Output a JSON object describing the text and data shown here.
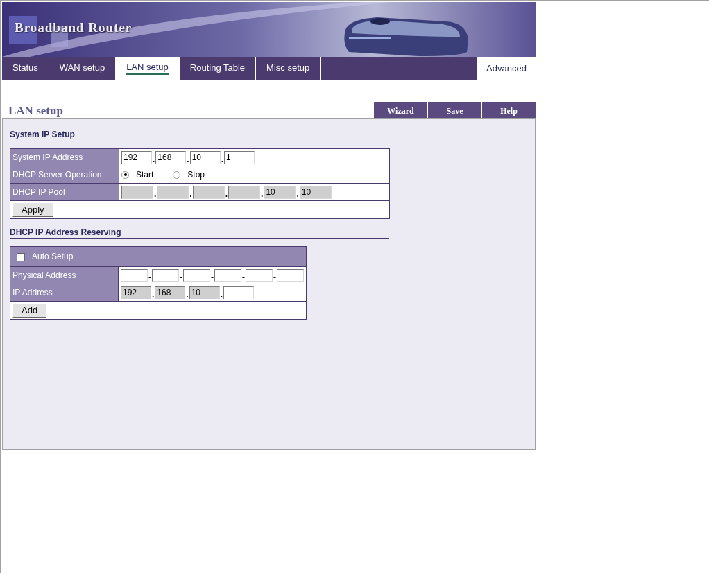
{
  "header": {
    "logo": "Broadband Router"
  },
  "tabs": [
    {
      "label": "Status",
      "selected": false
    },
    {
      "label": "WAN setup",
      "selected": false
    },
    {
      "label": "LAN setup",
      "selected": true
    },
    {
      "label": "Routing Table",
      "selected": false
    },
    {
      "label": "Misc setup",
      "selected": false
    }
  ],
  "advanced_tab": {
    "label": "Advanced",
    "selected": true
  },
  "page_title": "LAN setup",
  "actions": [
    "Wizard",
    "Save",
    "Help"
  ],
  "system_ip": {
    "title": "System IP Setup",
    "rows": [
      {
        "kind": "ip",
        "label": "System IP Address",
        "separator": ".",
        "fields": [
          {
            "value": "192",
            "disabled": false
          },
          {
            "value": "168",
            "disabled": false
          },
          {
            "value": "10",
            "disabled": false
          },
          {
            "value": "1",
            "disabled": false
          }
        ]
      },
      {
        "kind": "radio",
        "label": "DHCP Server Operation",
        "options": [
          {
            "label": "Start",
            "selected": true
          },
          {
            "label": "Stop",
            "selected": false
          }
        ]
      },
      {
        "kind": "pool",
        "label": "DHCP IP Pool",
        "separator": ".",
        "fields": [
          {
            "disabled": true
          },
          {
            "disabled": true
          },
          {
            "disabled": true
          },
          {
            "disabled": true
          },
          {
            "value": "10",
            "disabled": true
          },
          {
            "value": "10",
            "disabled": true
          }
        ]
      }
    ],
    "button": "Apply"
  },
  "reserving": {
    "title": "DHCP IP Address Reserving",
    "auto_setup": {
      "label": "Auto Setup",
      "checked": false
    },
    "rows": [
      {
        "kind": "mac",
        "label": "Physical Address",
        "separator": "-",
        "fields": [
          {
            "disabled": false
          },
          {
            "disabled": false
          },
          {
            "disabled": false
          },
          {
            "disabled": false
          },
          {
            "disabled": false
          },
          {
            "disabled": false
          }
        ]
      },
      {
        "kind": "ip",
        "label": "IP Address",
        "separator": ".",
        "fields": [
          {
            "value": "192",
            "disabled": true
          },
          {
            "value": "168",
            "disabled": true
          },
          {
            "value": "10",
            "disabled": true
          },
          {
            "disabled": false
          }
        ]
      }
    ],
    "button": "Add"
  }
}
